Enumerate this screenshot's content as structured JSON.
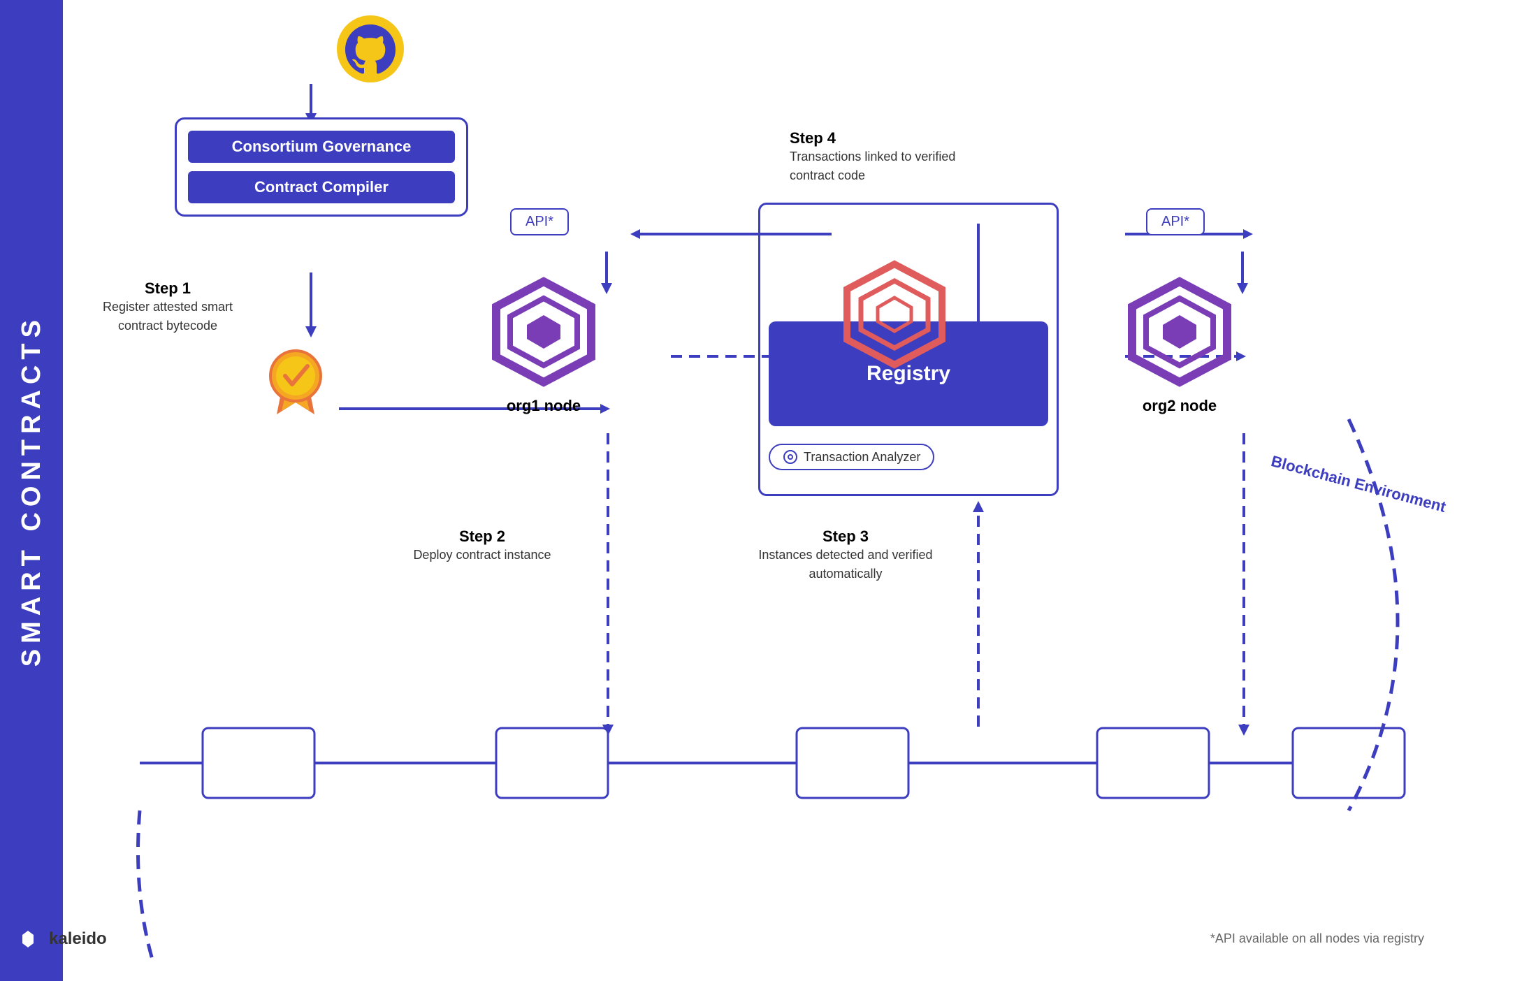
{
  "sidebar": {
    "text": "SMART CONTRACTS"
  },
  "github": {
    "icon_name": "github-icon"
  },
  "consortium_box": {
    "title": "Consortium Governance",
    "compiler_label": "Contract Compiler"
  },
  "steps": {
    "step1": {
      "label": "Step 1",
      "desc": "Register attested smart contract bytecode"
    },
    "step2": {
      "label": "Step 2",
      "desc": "Deploy contract  instance"
    },
    "step3": {
      "label": "Step 3",
      "desc": "Instances detected and verified automatically"
    },
    "step4": {
      "label": "Step 4",
      "desc": "Transactions linked to verified contract code"
    }
  },
  "nodes": {
    "org1": "org1 node",
    "org2": "org2 node"
  },
  "api": {
    "label": "API*"
  },
  "registry": {
    "label": "Registry"
  },
  "tx_analyzer": {
    "label": "Transaction Analyzer"
  },
  "blockchain_env": {
    "label": "Blockchain Environment"
  },
  "footer": {
    "note": "*API available on all nodes via registry"
  },
  "kaleido": {
    "text": "kaleido"
  },
  "colors": {
    "primary": "#3d3dbf",
    "badge_gold": "#f5a623",
    "badge_orange": "#e8743b",
    "registry_red": "#e05c5c",
    "purple_hex": "#7b3db5"
  }
}
